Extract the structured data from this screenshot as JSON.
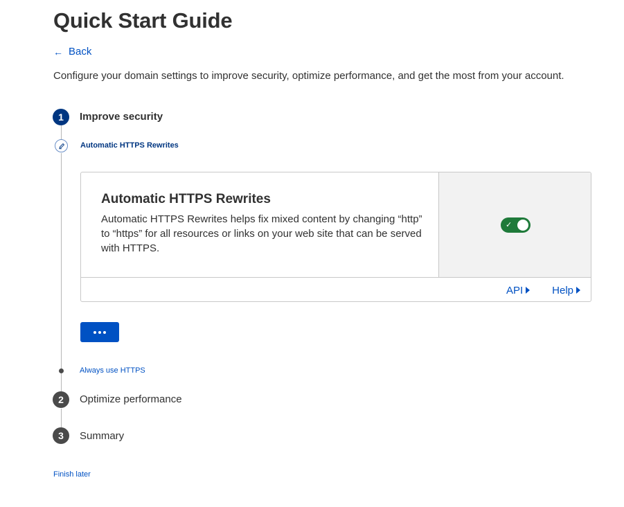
{
  "page": {
    "title": "Quick Start Guide",
    "back_label": "Back",
    "intro": "Configure your domain settings to improve security, optimize performance, and get the most from your account."
  },
  "steps": [
    {
      "number": "1",
      "title": "Improve security",
      "state": "active"
    },
    {
      "number": "2",
      "title": "Optimize performance",
      "state": "todo"
    },
    {
      "number": "3",
      "title": "Summary",
      "state": "todo"
    }
  ],
  "substeps": {
    "current": "Automatic HTTPS Rewrites",
    "next": "Always use HTTPS",
    "current_icon": "pencil-icon"
  },
  "card": {
    "title": "Automatic HTTPS Rewrites",
    "description": "Automatic HTTPS Rewrites helps fix mixed content by changing “http” to “https” for all resources or links on your web site that can be served with HTTPS.",
    "toggle_on": true,
    "links": {
      "api": "API",
      "help": "Help"
    }
  },
  "actions": {
    "more_button_icon": "ellipsis-icon",
    "finish_later": "Finish later"
  },
  "colors": {
    "primary": "#0051c3",
    "active_step": "#003681",
    "toggle_on": "#1f7a3a",
    "inactive_step": "#4a4a4a"
  }
}
